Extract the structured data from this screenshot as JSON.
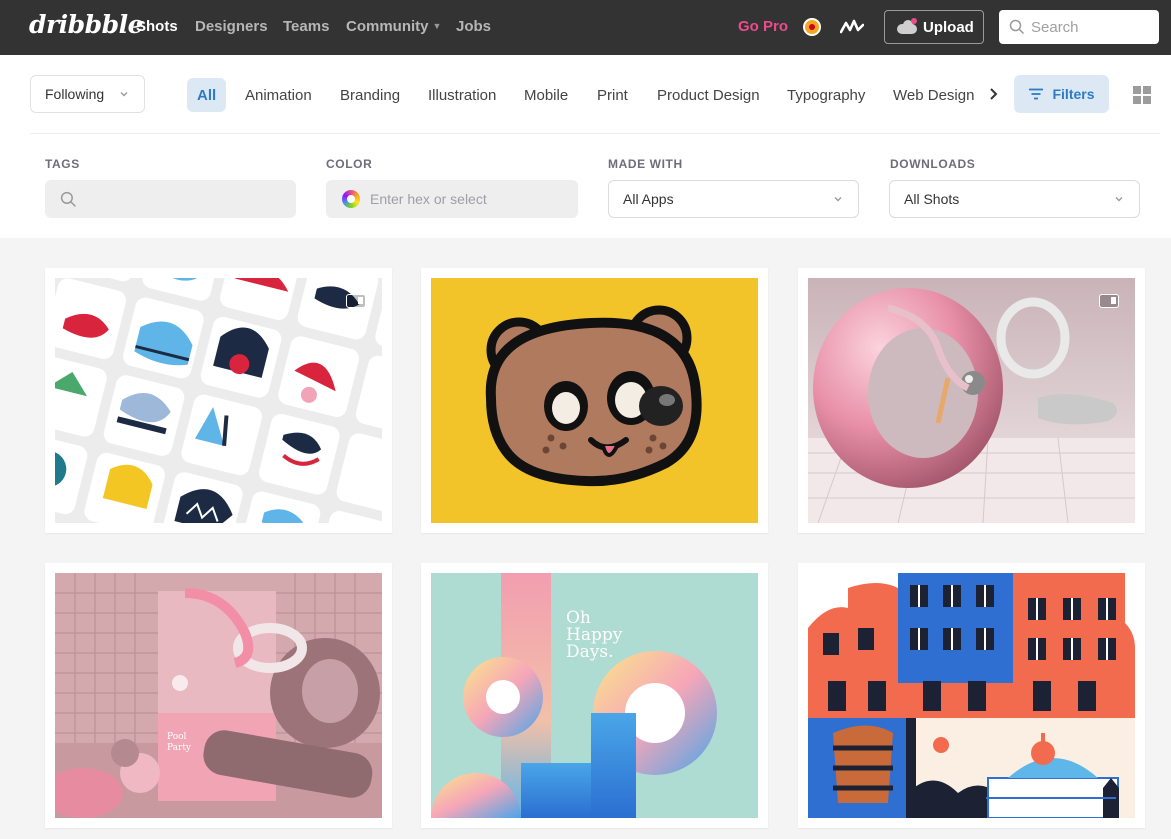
{
  "header": {
    "logo": "dribbble",
    "nav": [
      {
        "label": "Shots",
        "active": true
      },
      {
        "label": "Designers"
      },
      {
        "label": "Teams"
      },
      {
        "label": "Community",
        "has_menu": true
      },
      {
        "label": "Jobs"
      }
    ],
    "go_pro": "Go Pro",
    "upload_label": "Upload",
    "search_placeholder": "Search"
  },
  "filters": {
    "following": "Following",
    "categories": [
      "All",
      "Animation",
      "Branding",
      "Illustration",
      "Mobile",
      "Print",
      "Product Design",
      "Typography",
      "Web Design"
    ],
    "active_category": "All",
    "filters_label": "Filters",
    "tags_label": "TAGS",
    "color_label": "COLOR",
    "color_placeholder": "Enter hex or select",
    "made_with_label": "MADE WITH",
    "made_with_value": "All Apps",
    "downloads_label": "DOWNLOADS",
    "downloads_value": "All Shots"
  },
  "shots": [
    {
      "name": "icon-tiles",
      "animated": true
    },
    {
      "name": "bear-face",
      "animated": false
    },
    {
      "name": "pink-torus",
      "animated": true
    },
    {
      "name": "pool-party-poster",
      "animated": false,
      "poster_text": "Pool Party"
    },
    {
      "name": "oh-happy-days",
      "animated": false,
      "text": [
        "Oh",
        "Happy",
        "Days."
      ]
    },
    {
      "name": "city-buildings",
      "animated": false
    }
  ],
  "colors": {
    "topbar": "#333333",
    "pink": "#ea4c89",
    "accent_blue": "#2d7ac7",
    "accent_bg": "#dce9f5"
  }
}
